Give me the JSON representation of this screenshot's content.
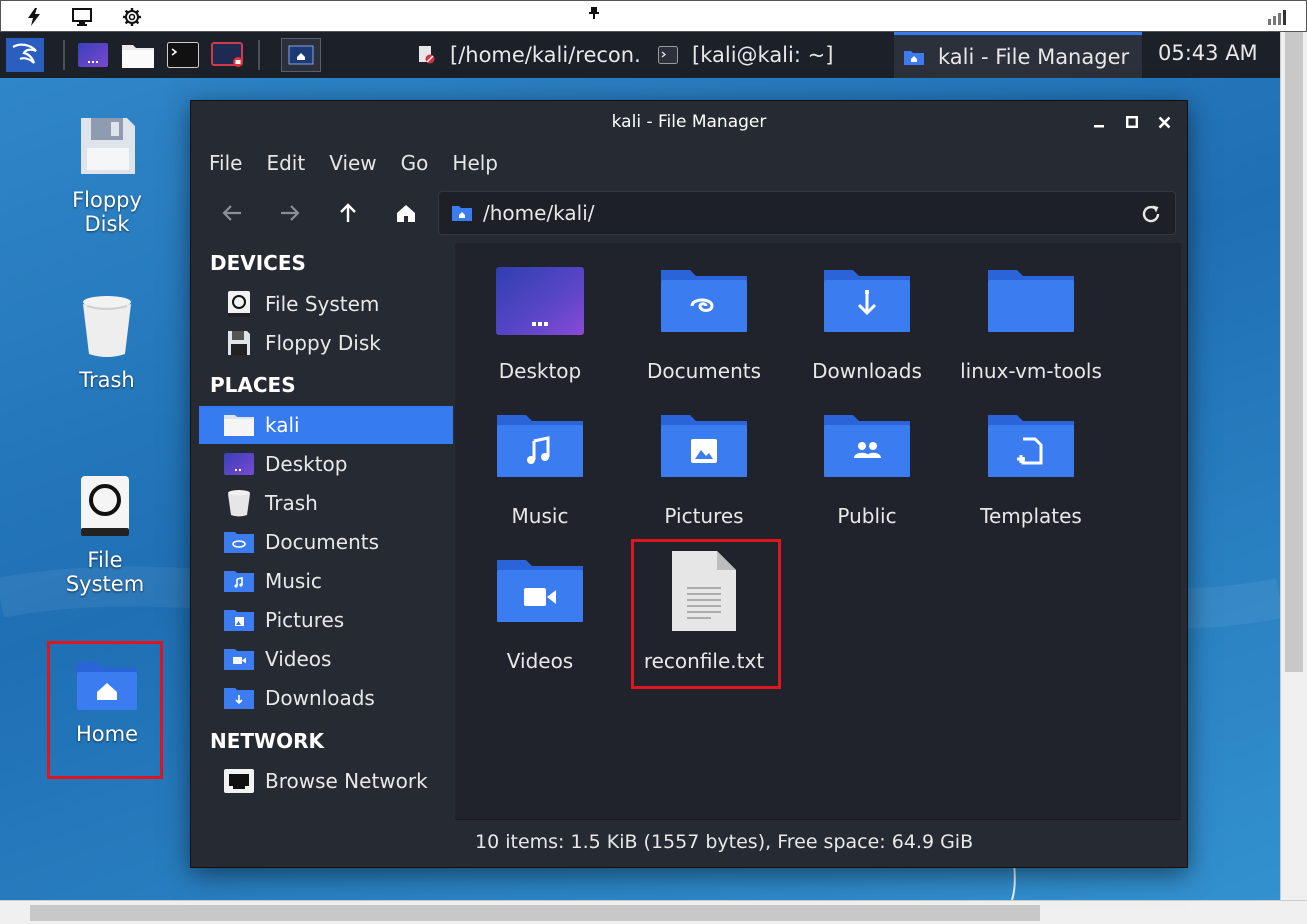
{
  "panel": {
    "tasks": [
      {
        "label": "[/home/kali/recon..."
      },
      {
        "label": "[kali@kali: ~]"
      },
      {
        "label": "kali - File Manager"
      }
    ],
    "clock": "05:43 AM"
  },
  "desktop": {
    "icons": [
      {
        "label": "Floppy Disk"
      },
      {
        "label": "Trash"
      },
      {
        "label": "File System"
      },
      {
        "label": "Home"
      }
    ]
  },
  "window": {
    "title": "kali - File Manager",
    "menu": [
      "File",
      "Edit",
      "View",
      "Go",
      "Help"
    ],
    "path": "/home/kali/",
    "sidebar": {
      "devices_header": "DEVICES",
      "devices": [
        {
          "label": "File System"
        },
        {
          "label": "Floppy Disk"
        }
      ],
      "places_header": "PLACES",
      "places": [
        {
          "label": "kali",
          "selected": true
        },
        {
          "label": "Desktop"
        },
        {
          "label": "Trash"
        },
        {
          "label": "Documents"
        },
        {
          "label": "Music"
        },
        {
          "label": "Pictures"
        },
        {
          "label": "Videos"
        },
        {
          "label": "Downloads"
        }
      ],
      "network_header": "NETWORK",
      "network": [
        {
          "label": "Browse Network"
        }
      ]
    },
    "files": [
      {
        "label": "Desktop",
        "icon": "desktop-folder-icon"
      },
      {
        "label": "Documents",
        "icon": "documents-folder-icon"
      },
      {
        "label": "Downloads",
        "icon": "downloads-folder-icon"
      },
      {
        "label": "linux-vm-tools",
        "icon": "folder-icon"
      },
      {
        "label": "Music",
        "icon": "music-folder-icon"
      },
      {
        "label": "Pictures",
        "icon": "pictures-folder-icon"
      },
      {
        "label": "Public",
        "icon": "public-folder-icon"
      },
      {
        "label": "Templates",
        "icon": "templates-folder-icon"
      },
      {
        "label": "Videos",
        "icon": "videos-folder-icon"
      },
      {
        "label": "reconfile.txt",
        "icon": "text-file-icon"
      }
    ],
    "status": "10 items: 1.5 KiB (1557 bytes), Free space: 64.9 GiB"
  },
  "colors": {
    "accent": "#367bf0",
    "folder": "#3b7cf0",
    "highlight": "#e0161f",
    "window_bg": "#262a33",
    "panel_bg": "#1c2028"
  }
}
